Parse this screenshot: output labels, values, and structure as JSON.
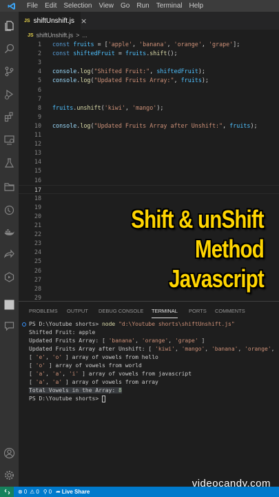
{
  "menu": [
    "File",
    "Edit",
    "Selection",
    "View",
    "Go",
    "Run",
    "Terminal",
    "Help"
  ],
  "tab": {
    "badge": "JS",
    "label": "shiftUnshift.js",
    "close": "×"
  },
  "breadcrumb": {
    "badge": "JS",
    "file": "shiftUnshift.js",
    "sep": ">",
    "more": "..."
  },
  "code_lines": [
    {
      "n": "1",
      "tokens": [
        [
          "kw",
          "const "
        ],
        [
          "var",
          "fruits"
        ],
        [
          "pun",
          " = ["
        ],
        [
          "str",
          "'apple'"
        ],
        [
          "pun",
          ", "
        ],
        [
          "str",
          "'banana'"
        ],
        [
          "pun",
          ", "
        ],
        [
          "str",
          "'orange'"
        ],
        [
          "pun",
          ", "
        ],
        [
          "str",
          "'grape'"
        ],
        [
          "pun",
          "];"
        ]
      ]
    },
    {
      "n": "2",
      "tokens": [
        [
          "kw",
          "const "
        ],
        [
          "var",
          "shiftedFruit"
        ],
        [
          "pun",
          " = "
        ],
        [
          "var",
          "fruits"
        ],
        [
          "pun",
          "."
        ],
        [
          "fn",
          "shift"
        ],
        [
          "pun",
          "();"
        ]
      ]
    },
    {
      "n": "3",
      "tokens": []
    },
    {
      "n": "4",
      "tokens": [
        [
          "id",
          "console"
        ],
        [
          "pun",
          "."
        ],
        [
          "fn",
          "log"
        ],
        [
          "pun",
          "("
        ],
        [
          "str",
          "\"Shifted Fruit:\""
        ],
        [
          "pun",
          ", "
        ],
        [
          "var",
          "shiftedFruit"
        ],
        [
          "pun",
          ");"
        ]
      ]
    },
    {
      "n": "5",
      "tokens": [
        [
          "id",
          "console"
        ],
        [
          "pun",
          "."
        ],
        [
          "fn",
          "log"
        ],
        [
          "pun",
          "("
        ],
        [
          "str",
          "\"Updated Fruits Array:\""
        ],
        [
          "pun",
          ", "
        ],
        [
          "var",
          "fruits"
        ],
        [
          "pun",
          ");"
        ]
      ]
    },
    {
      "n": "6",
      "tokens": []
    },
    {
      "n": "7",
      "tokens": []
    },
    {
      "n": "8",
      "tokens": [
        [
          "var",
          "fruits"
        ],
        [
          "pun",
          "."
        ],
        [
          "fn",
          "unshift"
        ],
        [
          "pun",
          "("
        ],
        [
          "str",
          "'kiwi'"
        ],
        [
          "pun",
          ", "
        ],
        [
          "str",
          "'mango'"
        ],
        [
          "pun",
          ");"
        ]
      ]
    },
    {
      "n": "9",
      "tokens": []
    },
    {
      "n": "10",
      "tokens": [
        [
          "id",
          "console"
        ],
        [
          "pun",
          "."
        ],
        [
          "fn",
          "log"
        ],
        [
          "pun",
          "("
        ],
        [
          "str",
          "\"Updated Fruits Array after Unshift:\""
        ],
        [
          "pun",
          ", "
        ],
        [
          "var",
          "fruits"
        ],
        [
          "pun",
          ");"
        ]
      ]
    },
    {
      "n": "11",
      "tokens": []
    },
    {
      "n": "12",
      "tokens": []
    },
    {
      "n": "13",
      "tokens": []
    },
    {
      "n": "14",
      "tokens": []
    },
    {
      "n": "15",
      "tokens": []
    },
    {
      "n": "16",
      "tokens": []
    },
    {
      "n": "17",
      "tokens": [],
      "active": true
    },
    {
      "n": "18",
      "tokens": []
    },
    {
      "n": "19",
      "tokens": []
    },
    {
      "n": "20",
      "tokens": []
    },
    {
      "n": "21",
      "tokens": []
    },
    {
      "n": "22",
      "tokens": []
    },
    {
      "n": "23",
      "tokens": []
    },
    {
      "n": "24",
      "tokens": []
    },
    {
      "n": "25",
      "tokens": []
    },
    {
      "n": "26",
      "tokens": []
    },
    {
      "n": "27",
      "tokens": []
    },
    {
      "n": "28",
      "tokens": []
    },
    {
      "n": "29",
      "tokens": []
    }
  ],
  "overlay": {
    "line1": "Shift & unShift",
    "line2": "Method",
    "line3": "Javascript",
    "color": "#ffd500"
  },
  "panel_tabs": [
    "PROBLEMS",
    "OUTPUT",
    "DEBUG CONSOLE",
    "TERMINAL",
    "PORTS",
    "COMMENTS"
  ],
  "active_panel_tab": "TERMINAL",
  "terminal_lines": [
    {
      "prompt": true,
      "tokens": [
        [
          "t",
          "PS D:\\Youtube shorts> "
        ],
        [
          "cmd",
          "node "
        ],
        [
          "cmdarg",
          "\"d:\\Youtube shorts\\shiftUnshift.js\""
        ]
      ]
    },
    {
      "tokens": [
        [
          "t",
          "Shifted Fruit: apple"
        ]
      ]
    },
    {
      "tokens": [
        [
          "t",
          "Updated Fruits Array: [ "
        ],
        [
          "tstr",
          "'banana'"
        ],
        [
          "t",
          ", "
        ],
        [
          "tstr",
          "'orange'"
        ],
        [
          "t",
          ", "
        ],
        [
          "tstr",
          "'grape'"
        ],
        [
          "t",
          " ]"
        ]
      ]
    },
    {
      "tokens": [
        [
          "t",
          "Updated Fruits Array after Unshift: [ "
        ],
        [
          "tstr",
          "'kiwi'"
        ],
        [
          "t",
          ", "
        ],
        [
          "tstr",
          "'mango'"
        ],
        [
          "t",
          ", "
        ],
        [
          "tstr",
          "'banana'"
        ],
        [
          "t",
          ", "
        ],
        [
          "tstr",
          "'orange'"
        ],
        [
          "t",
          ","
        ]
      ]
    },
    {
      "tokens": [
        [
          "t",
          "[ "
        ],
        [
          "tstr",
          "'e'"
        ],
        [
          "t",
          ", "
        ],
        [
          "tstr",
          "'o'"
        ],
        [
          "t",
          " ] array of vowels from hello"
        ]
      ]
    },
    {
      "tokens": [
        [
          "t",
          "[ "
        ],
        [
          "tstr",
          "'o'"
        ],
        [
          "t",
          " ] array of vowels from world"
        ]
      ]
    },
    {
      "tokens": [
        [
          "t",
          "[ "
        ],
        [
          "tstr",
          "'a'"
        ],
        [
          "t",
          ", "
        ],
        [
          "tstr",
          "'a'"
        ],
        [
          "t",
          ", "
        ],
        [
          "tstr",
          "'i'"
        ],
        [
          "t",
          " ] array of vowels from javascript"
        ]
      ]
    },
    {
      "tokens": [
        [
          "t",
          "[ "
        ],
        [
          "tstr",
          "'a'"
        ],
        [
          "t",
          ", "
        ],
        [
          "tstr",
          "'a'"
        ],
        [
          "t",
          " ] array of vowels from array"
        ]
      ]
    },
    {
      "highlight": true,
      "tokens": [
        [
          "t",
          "Total Vowels in the Array: "
        ],
        [
          "tnum",
          "8"
        ]
      ]
    },
    {
      "tokens": [
        [
          "t",
          "PS D:\\Youtube shorts> "
        ],
        [
          "cursor",
          ""
        ]
      ]
    }
  ],
  "watermark": "videocandy.com",
  "statusbar": {
    "errors": "0",
    "warnings": "0",
    "ports": "0",
    "live_share": "Live Share"
  },
  "colors": {
    "accent": "#007acc",
    "remote": "#16825d"
  }
}
